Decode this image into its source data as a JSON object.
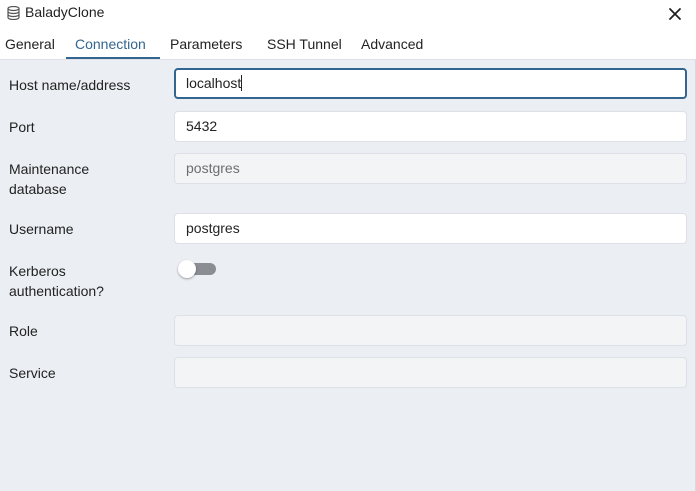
{
  "window": {
    "title": "BaladyClone",
    "icon": "server-icon",
    "close_icon": "close-icon"
  },
  "tabs": [
    {
      "label": "General",
      "active": false
    },
    {
      "label": "Connection",
      "active": true
    },
    {
      "label": "Parameters",
      "active": false
    },
    {
      "label": "SSH Tunnel",
      "active": false
    },
    {
      "label": "Advanced",
      "active": false
    }
  ],
  "form": {
    "host": {
      "label": "Host name/address",
      "value": "localhost"
    },
    "port": {
      "label": "Port",
      "value": "5432"
    },
    "maintenance_db": {
      "label_line1": "Maintenance",
      "label_line2": "database",
      "value": "postgres"
    },
    "username": {
      "label": "Username",
      "value": "postgres"
    },
    "kerberos": {
      "label_line1": "Kerberos",
      "label_line2": "authentication?",
      "enabled": false
    },
    "role": {
      "label": "Role",
      "value": ""
    },
    "service": {
      "label": "Service",
      "value": ""
    }
  },
  "colors": {
    "accent": "#326690",
    "background": "#ebeef3",
    "toggle_off": "#8a8d91"
  }
}
